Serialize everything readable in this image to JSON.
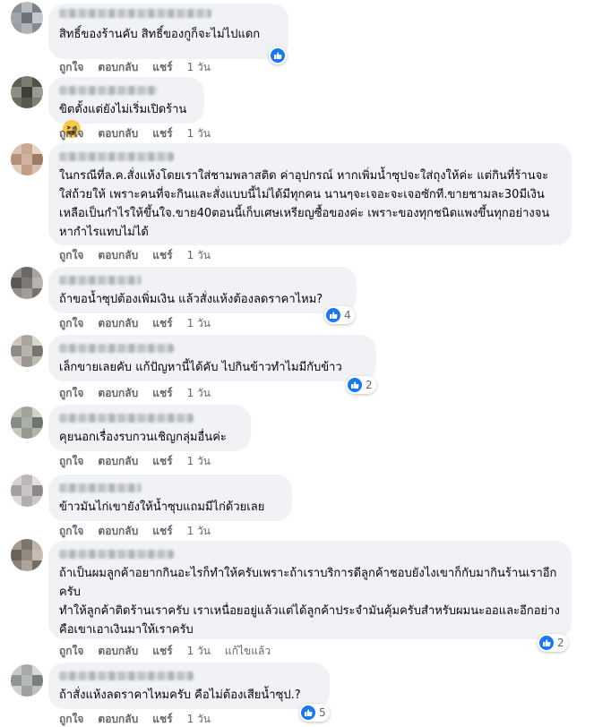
{
  "actions": {
    "like": "ถูกใจ",
    "reply": "ตอบกลับ",
    "share": "แชร์",
    "edited": "แก้ไขแล้ว"
  },
  "icons": {
    "like": "thumbs-up-icon",
    "haha": "laughing-face-icon"
  },
  "colors": {
    "bubble": "#f0f2f5",
    "like_blue": "#1877f2",
    "meta_gray": "#65676b"
  },
  "comments": [
    {
      "text": "สิทธิ์ของร้านคับ สิทธิ์ของกูก็จะไม่ไปแดก",
      "time": "1 วัน",
      "reaction_count": ""
    },
    {
      "text": "ขิตตั้งแต่ยังไม่เริ่มเปิดร้าน",
      "time": "1 วัน",
      "reaction_count": ""
    },
    {
      "text": "ในกรณีที่ล.ค.สั่งแห้งโดยเราใส่ชามพลาสติด ค่าอุปกรณ์ หากเพิ่มน้ำซุปจะใส่ถุงให้ค่ะ แต่กินที่ร้านจะใส่ถ้วยให้ เพราะคนที่จะกินและสั่งแบบนี้ไม่ได้มีทุกคน นานๆจะเจอะจะเจอซักที.ขายชามละ30มีเงินเหลือเป็นกำไรให้ขึ้นใจ.ขาย40ตอนนี้เก็บเศษเหรียญซื้อของค่ะ เพราะของทุกชนิดแพงขึ้นทุกอย่างจนหากำไรแทบไม่ได้",
      "time": "1 วัน",
      "reaction_count": ""
    },
    {
      "text": "ถ้าขอน้ำซุปต้องเพิ่มเงิน แล้วสั่งแห้งต้องลดราคาไหม?",
      "time": "1 วัน",
      "reaction_count": "4"
    },
    {
      "text": "เล็กขายเลยคับ แก้ปัญหานี้ได้คับ ไปกินข้าวทำไมมีกับข้าว",
      "time": "1 วัน",
      "reaction_count": "2"
    },
    {
      "text": "คุยนอกเรื่องรบกวนเชิญกลุ่มอื่นค่ะ",
      "time": "1 วัน",
      "reaction_count": ""
    },
    {
      "text": "ข้าวมันไก่เขายังให้น้ำซุบแถมมีไก่ด้วยเลย",
      "time": "1 วัน",
      "reaction_count": ""
    },
    {
      "text": "ถ้าเป็นผมลูกค้าอยากกินอะไรก็ทำให้ครับเพราะถ้าเราบริการดีลูกค้าชอบยังไงเขาก็กับมากินร้านเราอีกครับ\nทำให้ลูกค้าติดร้านเราครับ เราเหนื่อยอยู่แล้วแต่ได้ลูกค้าประจำมันคุ้มครับสำหรับผมนะออและอีกอย่างคือเขาเอาเงินมาให้เราครับ",
      "time": "1 วัน",
      "reaction_count": "2"
    },
    {
      "text": "ถ้าสั่งแห้งลดราคาไหมครับ คือไม่ต้องเสียน้ำซุป.?",
      "time": "1 วัน",
      "reaction_count": "5"
    }
  ]
}
